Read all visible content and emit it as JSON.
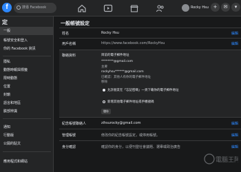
{
  "topbar": {
    "search_placeholder": "搜尋 Facebook",
    "profile_name": "Rocky Hsu"
  },
  "sidebar": {
    "title": "定",
    "items": [
      {
        "label": "一般",
        "active": true
      },
      {
        "label": "帳號安全和登入",
        "active": false
      },
      {
        "label": "你的 Facebook 資訊",
        "active": false
      },
      {
        "label": "隱私",
        "active": false
      },
      {
        "label": "動態時報與標籤",
        "active": false
      },
      {
        "label": "限時動態",
        "active": false
      },
      {
        "label": "位置",
        "active": false
      },
      {
        "label": "封鎖",
        "active": false
      },
      {
        "label": "語言和地區",
        "active": false
      },
      {
        "label": "臉部辨識",
        "active": false
      },
      {
        "label": "通知",
        "active": false
      },
      {
        "label": "行動版",
        "active": false
      },
      {
        "label": "公開的貼文",
        "active": false
      },
      {
        "label": "應用程式和網站",
        "active": false
      }
    ]
  },
  "main": {
    "title": "一般帳號設定",
    "name_label": "姓名",
    "name_value": "Rocky Hsu",
    "username_label": "用戶名稱",
    "username_value": "https://www.facebook.com/RockyHsu",
    "edit_label": "編輯",
    "contact_label": "聯絡資料",
    "contact_line1": "目前的電子郵件地址",
    "email1": "********@gmail.com",
    "primary_label": "主要",
    "email2": "rockyhsu******@gmail.com",
    "confirmed_label": "已確認：其他人有你的電子郵件地址",
    "remove_label": "移除",
    "option1": "允許朋友在「忘記密碼」一頁下載你的電子郵件地址",
    "option2": "新增其他電子郵件地址或手機號碼",
    "save_label": "儲存",
    "memorial_label": "紀念帳號聯絡人",
    "memorial_value": "zihsurocky@gmail.com",
    "manage_label": "管理帳號",
    "manage_value": "修改你的紀念帳號設定，或停用帳號。",
    "identity_label": "身分確認",
    "identity_value": "確認你的身分，以便刊登社會議題、選舉或政治廣告"
  },
  "watermark": "電腦王阿達"
}
